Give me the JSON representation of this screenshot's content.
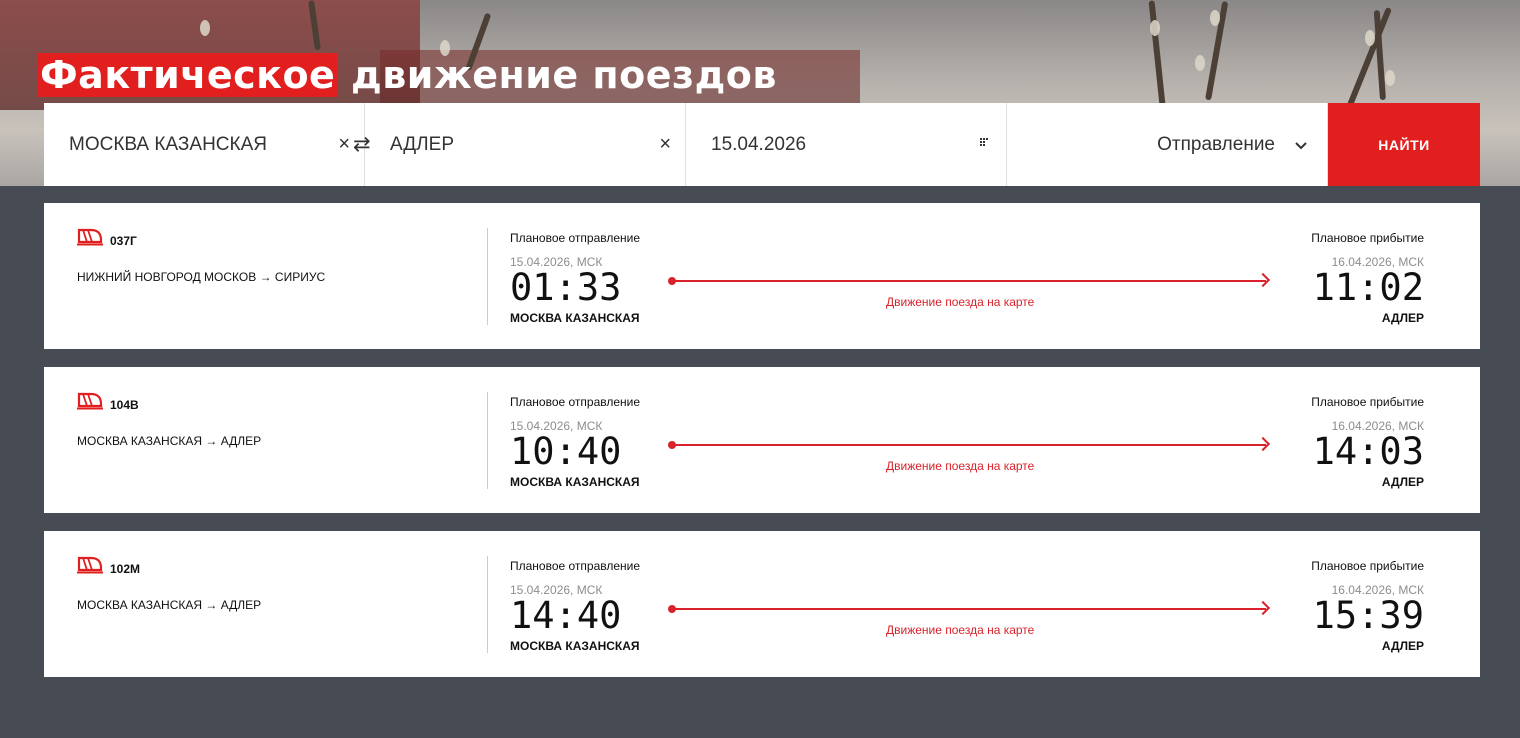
{
  "page": {
    "title_highlight": "Фактическое",
    "title_rest": " движение поездов"
  },
  "search": {
    "from": "МОСКВА КАЗАНСКАЯ",
    "to": "АДЛЕР",
    "date": "15.04.2026",
    "direction": "Отправление",
    "clear_symbol": "×",
    "swap_symbol": "⇄",
    "find_label": "НАЙТИ"
  },
  "colors": {
    "accent": "#e21f1f",
    "background": "#474b54"
  },
  "trains": [
    {
      "number": "037Г",
      "route": "НИЖНИЙ НОВГОРОД МОСКОВ → СИРИУС",
      "dep_label": "Плановое отправление",
      "dep_date": "15.04.2026, МСК",
      "dep_time": "01:33",
      "dep_station": "МОСКВА КАЗАНСКАЯ",
      "map_link": "Движение поезда на карте",
      "arr_label": "Плановое прибытие",
      "arr_date": "16.04.2026, МСК",
      "arr_time": "11:02",
      "arr_station": "АДЛЕР"
    },
    {
      "number": "104В",
      "route": "МОСКВА КАЗАНСКАЯ → АДЛЕР",
      "dep_label": "Плановое отправление",
      "dep_date": "15.04.2026, МСК",
      "dep_time": "10:40",
      "dep_station": "МОСКВА КАЗАНСКАЯ",
      "map_link": "Движение поезда на карте",
      "arr_label": "Плановое прибытие",
      "arr_date": "16.04.2026, МСК",
      "arr_time": "14:03",
      "arr_station": "АДЛЕР"
    },
    {
      "number": "102М",
      "route": "МОСКВА КАЗАНСКАЯ → АДЛЕР",
      "dep_label": "Плановое отправление",
      "dep_date": "15.04.2026, МСК",
      "dep_time": "14:40",
      "dep_station": "МОСКВА КАЗАНСКАЯ",
      "map_link": "Движение поезда на карте",
      "arr_label": "Плановое прибытие",
      "arr_date": "16.04.2026, МСК",
      "arr_time": "15:39",
      "arr_station": "АДЛЕР"
    }
  ]
}
